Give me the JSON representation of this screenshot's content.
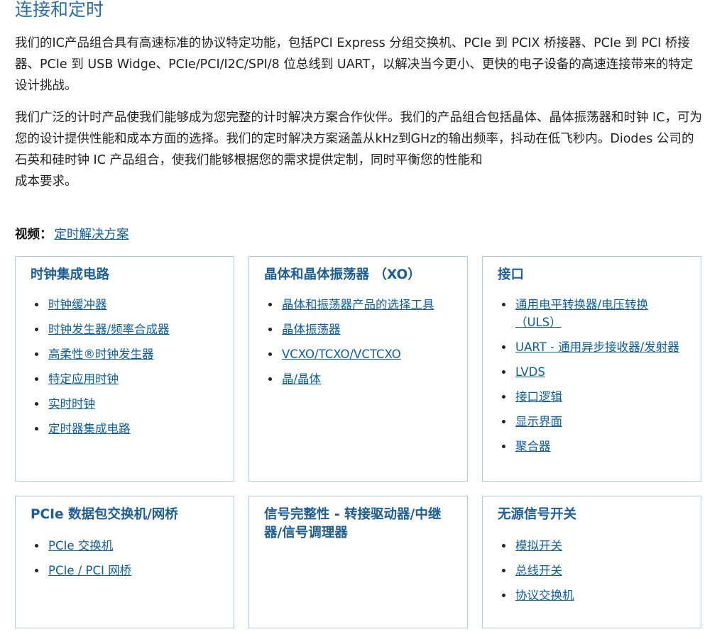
{
  "heading": "连接和定时",
  "paragraphs": {
    "p1": "我们的IC产品组合具有高速标准的协议特定功能，包括PCI Express 分组交换机、PCIe 到 PCIX 桥接器、PCIe 到 PCI 桥接器、PCIe 到 USB Widge、PCIe/PCI/I2C/SPI/8 位总线到 UART，以解决当今更小、更快的电子设备的高速连接带来的特定设计挑战。",
    "p2a": "我们广泛的计时产品使我们能够成为您完整的计时解决方案合作伙伴。我们的产品组合包括晶体、晶体振荡器和时钟 IC，可为您的设计提供性能和成本方面的选择。我们的定时解决方案涵盖从kHz到GHz的输出频率，抖动在低飞秒内。Diodes 公司的石英和硅时钟 IC 产品组合，使我们能够根据您的需求提供定制，同时平衡您的性能和",
    "p2b": "成本要求。"
  },
  "video": {
    "label": "视频：",
    "link": "定时解决方案"
  },
  "cards": [
    {
      "title": "时钟集成电路",
      "items": [
        "时钟缓冲器",
        "时钟发生器/频率合成器",
        "高柔性®时钟发生器",
        "特定应用时钟",
        "实时时钟",
        "定时器集成电路"
      ]
    },
    {
      "title": "晶体和晶体振荡器 （XO）",
      "items": [
        "晶体和振荡器产品的选择工具",
        "晶体振荡器",
        "VCXO/TCXO/VCTCXO",
        "晶/晶体"
      ]
    },
    {
      "title": "接口",
      "items": [
        "通用电平转换器/电压转换（ULS）",
        "UART - 通用异步接收器/发射器",
        "LVDS",
        "接口逻辑",
        "显示界面",
        "聚合器"
      ]
    },
    {
      "title": "PCIe 数据包交换机/网桥",
      "items": [
        "PCIe 交换机",
        "PCIe / PCI 网桥"
      ]
    },
    {
      "title": "信号完整性 - 转接驱动器/中继器/信号调理器",
      "items": []
    },
    {
      "title": "无源信号开关",
      "items": [
        "模拟开关",
        "总线开关",
        "协议交换机"
      ]
    }
  ]
}
